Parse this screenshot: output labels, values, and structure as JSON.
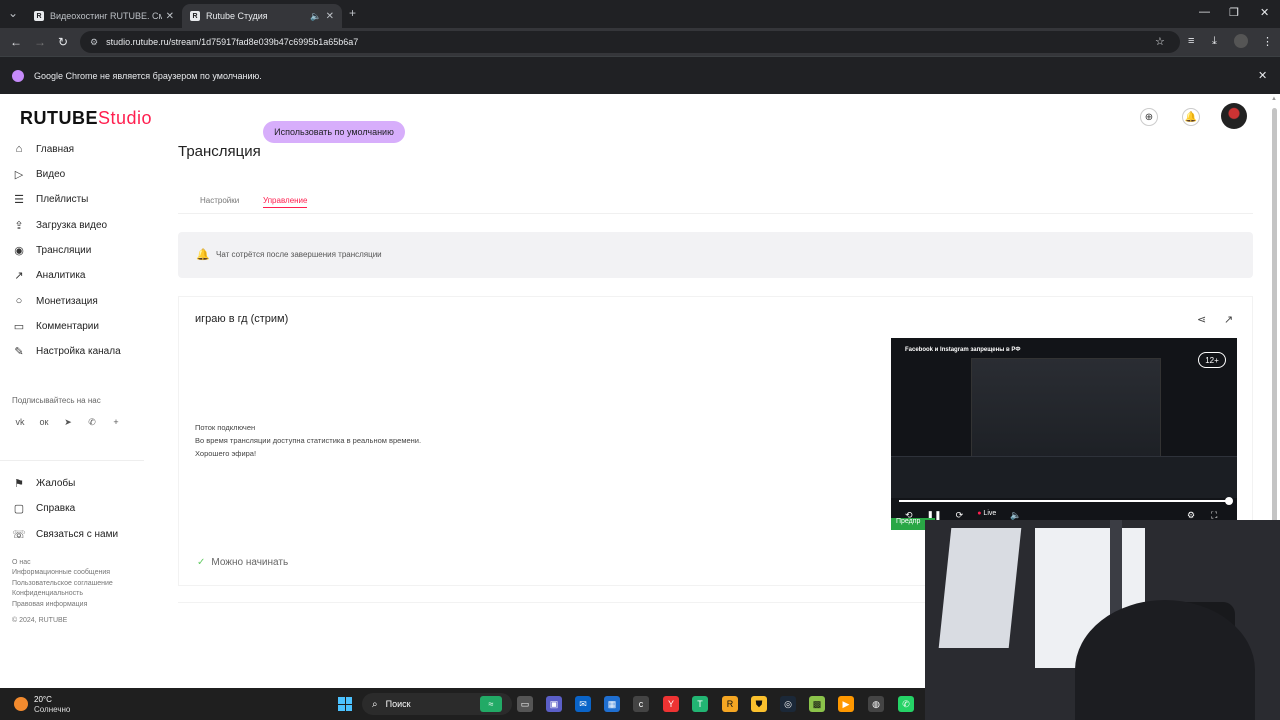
{
  "browser": {
    "tabs": [
      {
        "title": "Видеохостинг RUTUBE. Смотрите",
        "active": false
      },
      {
        "title": "Rutube Студия",
        "active": true
      }
    ],
    "url": "studio.rutube.ru/stream/1d75917fad8e039b47c6995b1a65b6a7",
    "favicon_letter": "R",
    "infobar": {
      "message": "Google Chrome не является браузером по умолчанию.",
      "button": "Использовать по умолчанию"
    }
  },
  "logo": {
    "brand": "RUTUBE",
    "product": "Studio"
  },
  "sidebar": {
    "items": [
      {
        "label": "Главная",
        "icon": "home-icon"
      },
      {
        "label": "Видео",
        "icon": "video-icon"
      },
      {
        "label": "Плейлисты",
        "icon": "playlist-icon"
      },
      {
        "label": "Загрузка видео",
        "icon": "upload-icon"
      },
      {
        "label": "Трансляции",
        "icon": "broadcast-icon"
      },
      {
        "label": "Аналитика",
        "icon": "analytics-icon"
      },
      {
        "label": "Монетизация",
        "icon": "monetization-icon"
      },
      {
        "label": "Комментарии",
        "icon": "comments-icon"
      },
      {
        "label": "Настройка канала",
        "icon": "channel-settings-icon"
      }
    ],
    "subscribe_label": "Подписывайтесь на нас",
    "socials": [
      "vk-icon",
      "ok-icon",
      "telegram-icon",
      "viber-icon",
      "more-icon"
    ],
    "support_items": [
      {
        "label": "Жалобы",
        "icon": "flag-icon"
      },
      {
        "label": "Справка",
        "icon": "help-icon"
      },
      {
        "label": "Связаться с нами",
        "icon": "contact-icon"
      }
    ],
    "footer_links": [
      "О нас",
      "Информационные сообщения",
      "Пользовательское соглашение",
      "Конфиденциальность",
      "Правовая информация",
      "© 2024, RUTUBE"
    ]
  },
  "main": {
    "title": "Трансляция",
    "tabs": [
      {
        "label": "Настройки",
        "active": false
      },
      {
        "label": "Управление",
        "active": true
      }
    ],
    "notice": "Чат сотрётся после завершения трансляции",
    "stream": {
      "title": "играю в гд (стрим)",
      "status_lines": [
        "Поток подключен",
        "Во время трансляции доступна статистика в реальном времени.",
        "Хорошего эфира!"
      ],
      "ready": "Можно начинать",
      "player": {
        "headline": "Facebook и Instagram запрещены в РФ",
        "age_rating": "12+",
        "live_label": "Live",
        "progress": 0.99,
        "preview_badge": "Предпр"
      }
    }
  },
  "taskbar": {
    "weather_temp": "20°C",
    "weather_desc": "Солнечно",
    "search": "Поиск"
  },
  "colors": {
    "accent": "#ff1f4f",
    "browser_dark": "#202124",
    "chrome_button": "#d7aefb"
  }
}
